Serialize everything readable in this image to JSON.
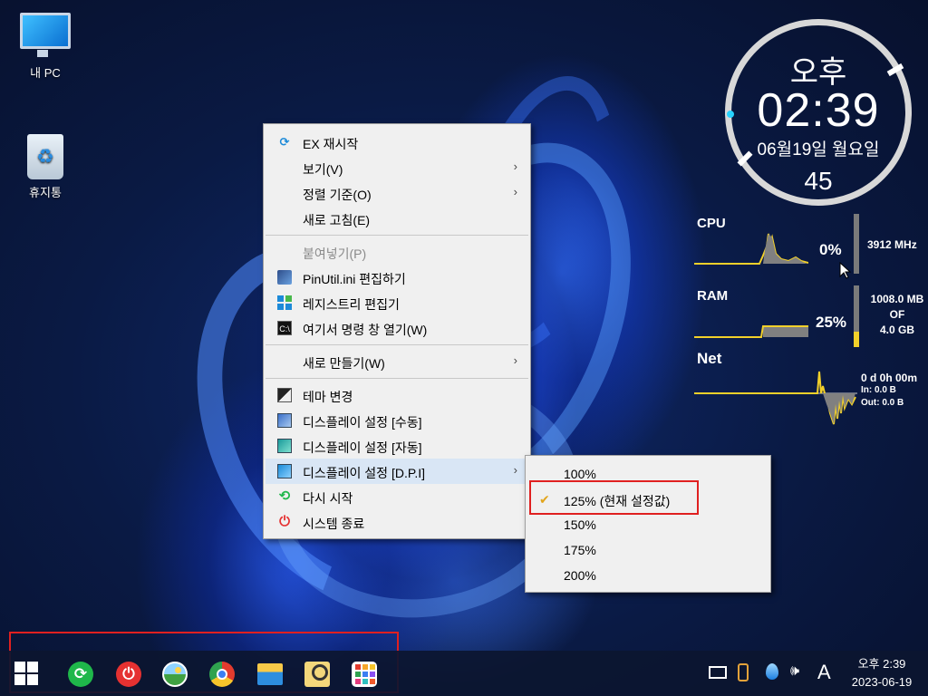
{
  "desktop": {
    "icons": [
      {
        "label": "내 PC",
        "icon": "monitor-icon"
      },
      {
        "label": "휴지통",
        "icon": "recycle-bin-icon"
      }
    ]
  },
  "context_menu": {
    "items": [
      {
        "label": "EX 재시작",
        "icon": "refresh-icon"
      },
      {
        "label": "보기(V)",
        "has_submenu": true
      },
      {
        "label": "정렬 기준(O)",
        "has_submenu": true
      },
      {
        "label": "새로 고침(E)"
      },
      {
        "label": "붙여넣기(P)",
        "disabled": true
      },
      {
        "label": "PinUtil.ini 편집하기",
        "icon": "pinutil-icon"
      },
      {
        "label": "레지스트리 편집기",
        "icon": "registry-icon"
      },
      {
        "label": "여기서 명령 창 열기(W)",
        "icon": "cmd-icon"
      },
      {
        "label": "새로 만들기(W)",
        "has_submenu": true
      },
      {
        "label": "테마 변경",
        "icon": "theme-icon"
      },
      {
        "label": "디스플레이 설정 [수동]",
        "icon": "display-icon"
      },
      {
        "label": "디스플레이 설정 [자동]",
        "icon": "display-icon"
      },
      {
        "label": "디스플레이 설정 [D.P.I]",
        "icon": "display-icon",
        "has_submenu": true,
        "active": true
      },
      {
        "label": "다시 시작",
        "icon": "restart-icon"
      },
      {
        "label": "시스템 종료",
        "icon": "power-icon"
      }
    ],
    "arrow_glyph": "›",
    "cmd_icon_text": "C:\\"
  },
  "dpi_submenu": {
    "items": [
      {
        "label": "100%"
      },
      {
        "label": "125% (현재 설정값)",
        "checked": true
      },
      {
        "label": "150%"
      },
      {
        "label": "175%"
      },
      {
        "label": "200%"
      }
    ]
  },
  "clock_widget": {
    "ampm": "오후",
    "time": "02:39",
    "date": "06월19일 월요일",
    "seconds": "45"
  },
  "system_monitor": {
    "cpu": {
      "label": "CPU",
      "usage": "0%",
      "frequency": "3912 MHz",
      "level": 0.0
    },
    "ram": {
      "label": "RAM",
      "usage": "25%",
      "used": "1008.0 MB",
      "of": "OF",
      "total": "4.0 GB",
      "level": 0.25
    },
    "net": {
      "label": "Net",
      "uptime": "0 d 0h 00m",
      "in": "In: 0.0 B",
      "out": "Out: 0.0 B"
    },
    "graph_color": "#f2d02a"
  },
  "taskbar": {
    "apps": [
      {
        "name": "start-button",
        "icon": "windows-icon"
      },
      {
        "name": "restart-app",
        "icon": "restart-icon"
      },
      {
        "name": "power-app",
        "icon": "power-icon"
      },
      {
        "name": "photos-app",
        "icon": "photo-icon"
      },
      {
        "name": "chrome-app",
        "icon": "chrome-icon"
      },
      {
        "name": "explorer-app",
        "icon": "folder-icon"
      },
      {
        "name": "search-tool-app",
        "icon": "magnifier-icon"
      },
      {
        "name": "apps-grid",
        "icon": "apps-grid-icon"
      }
    ],
    "tray": {
      "ime": "A",
      "speaker_glyph": "🕪",
      "time": "오후 2:39",
      "date": "2023-06-19"
    }
  },
  "colors": {
    "highlight_box": "#e02020",
    "menu_bg": "#f0f0f0",
    "menu_active": "#d9e6f5"
  }
}
